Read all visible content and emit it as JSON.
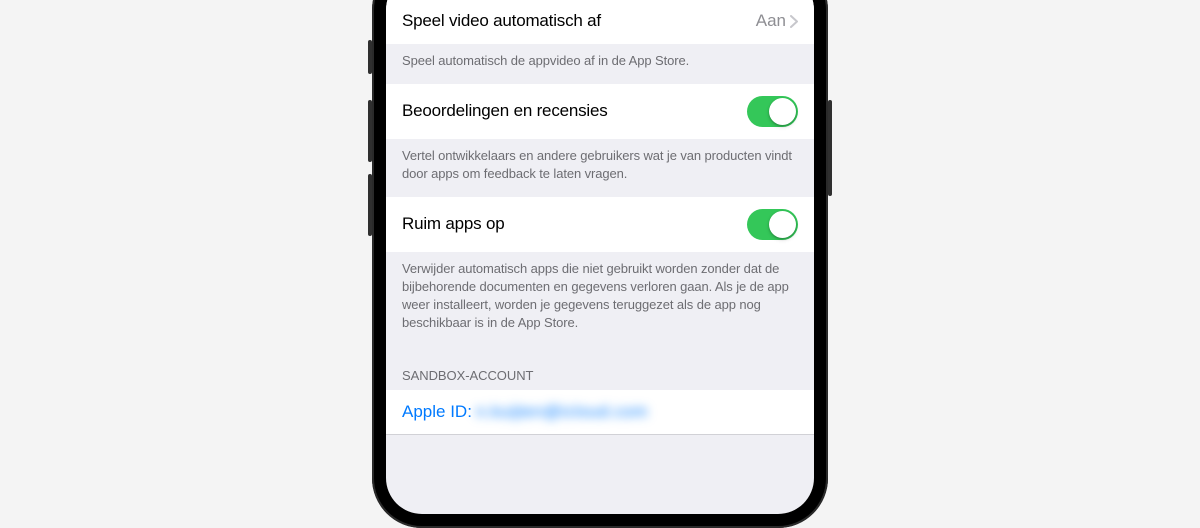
{
  "rows": {
    "autoplay": {
      "label": "Speel video automatisch af",
      "value": "Aan",
      "footer": "Speel automatisch de appvideo af in de App Store."
    },
    "reviews": {
      "label": "Beoordelingen en recensies",
      "footer": "Vertel ontwikkelaars en andere gebruikers wat je van producten vindt door apps om feedback te laten vragen."
    },
    "offload": {
      "label": "Ruim apps op",
      "footer": "Verwijder automatisch apps die niet gebruikt worden zonder dat de bijbehorende documenten en gegevens verloren gaan. Als je de app weer installeert, worden je gegevens teruggezet als de app nog beschikbaar is in de App Store."
    }
  },
  "sandbox": {
    "header": "SANDBOX-ACCOUNT",
    "apple_id_label": "Apple ID:",
    "apple_id_value": "n.kuijten@icloud.com"
  }
}
